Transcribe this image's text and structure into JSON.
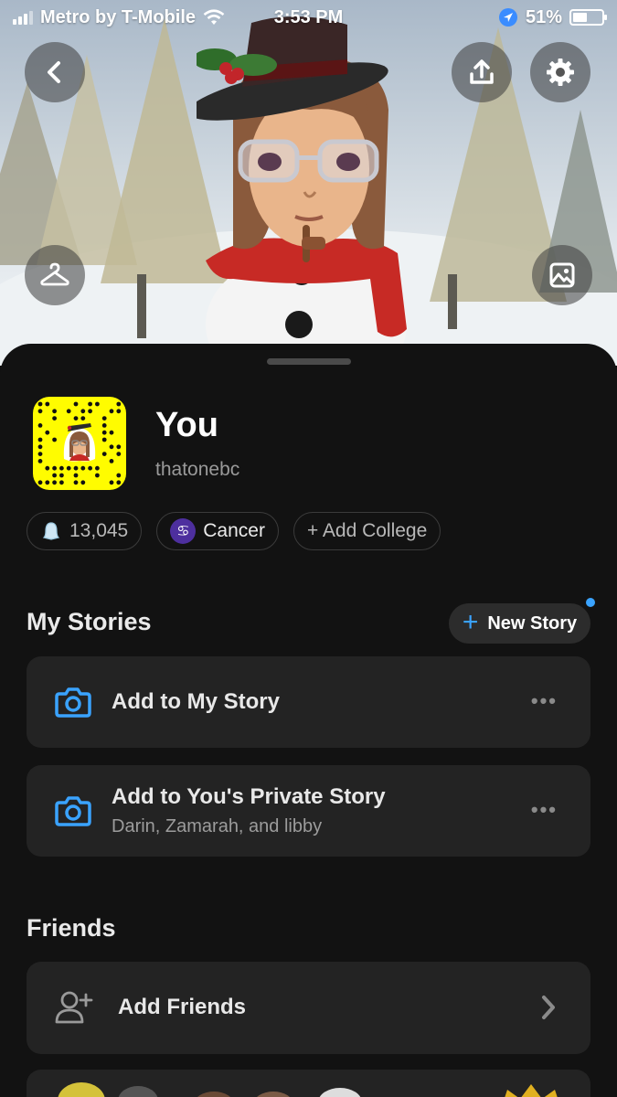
{
  "status_bar": {
    "carrier": "Metro by T-Mobile",
    "time": "3:53 PM",
    "battery": "51%",
    "battery_level": 0.51
  },
  "header": {
    "back_icon": "chevron-left-icon",
    "share_icon": "share-upload-icon",
    "settings_icon": "gear-icon",
    "wardrobe_icon": "hanger-icon",
    "background_icon": "image-icon"
  },
  "profile": {
    "display_name": "You",
    "username": "thatonebc",
    "snapcode_color": "#fffc00"
  },
  "chips": {
    "score": "13,045",
    "zodiac": "Cancer",
    "zodiac_glyph": "♋",
    "college": "+ Add College"
  },
  "my_stories": {
    "title": "My Stories",
    "new_story_label": "New Story",
    "new_story_plus": "+",
    "items": [
      {
        "title": "Add to My Story",
        "subtitle": ""
      },
      {
        "title": "Add to You's Private Story",
        "subtitle": "Darin, Zamarah, and libby"
      }
    ],
    "more_label": "•••"
  },
  "friends": {
    "title": "Friends",
    "add_friends_label": "Add Friends"
  },
  "colors": {
    "accent_blue": "#3aa3ff",
    "sheet_bg": "#121212",
    "card_bg": "#232323"
  }
}
